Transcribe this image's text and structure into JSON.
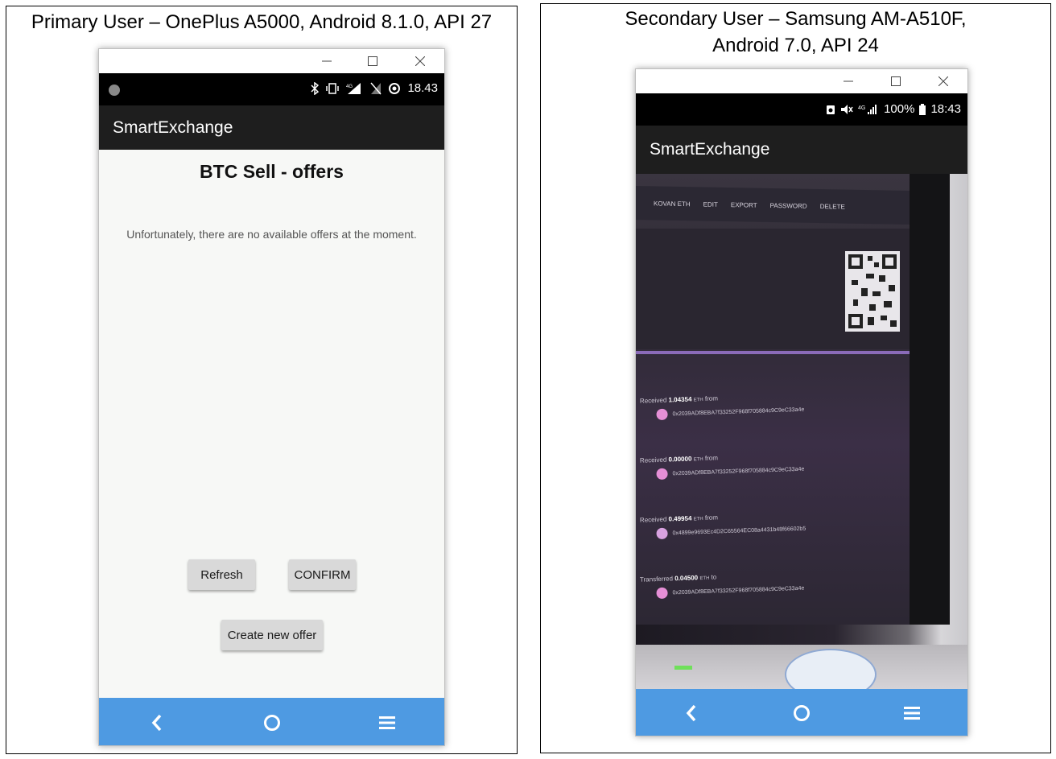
{
  "primary": {
    "caption": "Primary User – OnePlus A5000, Android 8.1.0, API 27",
    "status_time": "18.43",
    "app_title": "SmartExchange",
    "page_title": "BTC Sell - offers",
    "empty_message": "Unfortunately, there are no available offers at the moment.",
    "refresh_label": "Refresh",
    "confirm_label": "CONFIRM",
    "create_label": "Create new offer"
  },
  "secondary": {
    "caption": "Secondary User – Samsung AM-A510F, Android 7.0, API 24",
    "status_battery": "100%",
    "status_time": "18:43",
    "app_title": "SmartExchange",
    "camera": {
      "tabs": [
        "KOVAN ETH",
        "EDIT",
        "EXPORT",
        "PASSWORD",
        "DELETE"
      ],
      "transactions": [
        {
          "verb": "Received",
          "amount": "1.04354",
          "unit": "ETH",
          "direction": "from",
          "address": "0x2039ADf8EBA7f33252F968f705884c9C9eC33a4e"
        },
        {
          "verb": "Received",
          "amount": "0.00000",
          "unit": "ETH",
          "direction": "from",
          "address": "0x2039ADf8EBA7f33252F968f705884c9C9eC33a4e"
        },
        {
          "verb": "Received",
          "amount": "0.49954",
          "unit": "ETH",
          "direction": "from",
          "address": "0x4899e9693Ec4D2C65564EC08a4431b48f66602b5"
        },
        {
          "verb": "Transferred",
          "amount": "0.04500",
          "unit": "ETH",
          "direction": "to",
          "address": "0x2039ADf8EBA7f33252F968f705884c9C9eC33a4e"
        }
      ]
    }
  },
  "colors": {
    "navbar": "#4e9ae2",
    "appbar": "#1e1e1e",
    "content_bg": "#f7f8f6",
    "button_bg": "#d9d9d9"
  },
  "icons": [
    "minimize-icon",
    "maximize-icon",
    "close-icon",
    "back-icon",
    "home-icon",
    "menu-icon",
    "bluetooth-icon",
    "vibrate-icon",
    "signal-icon",
    "battery-icon",
    "qr-code-icon"
  ]
}
